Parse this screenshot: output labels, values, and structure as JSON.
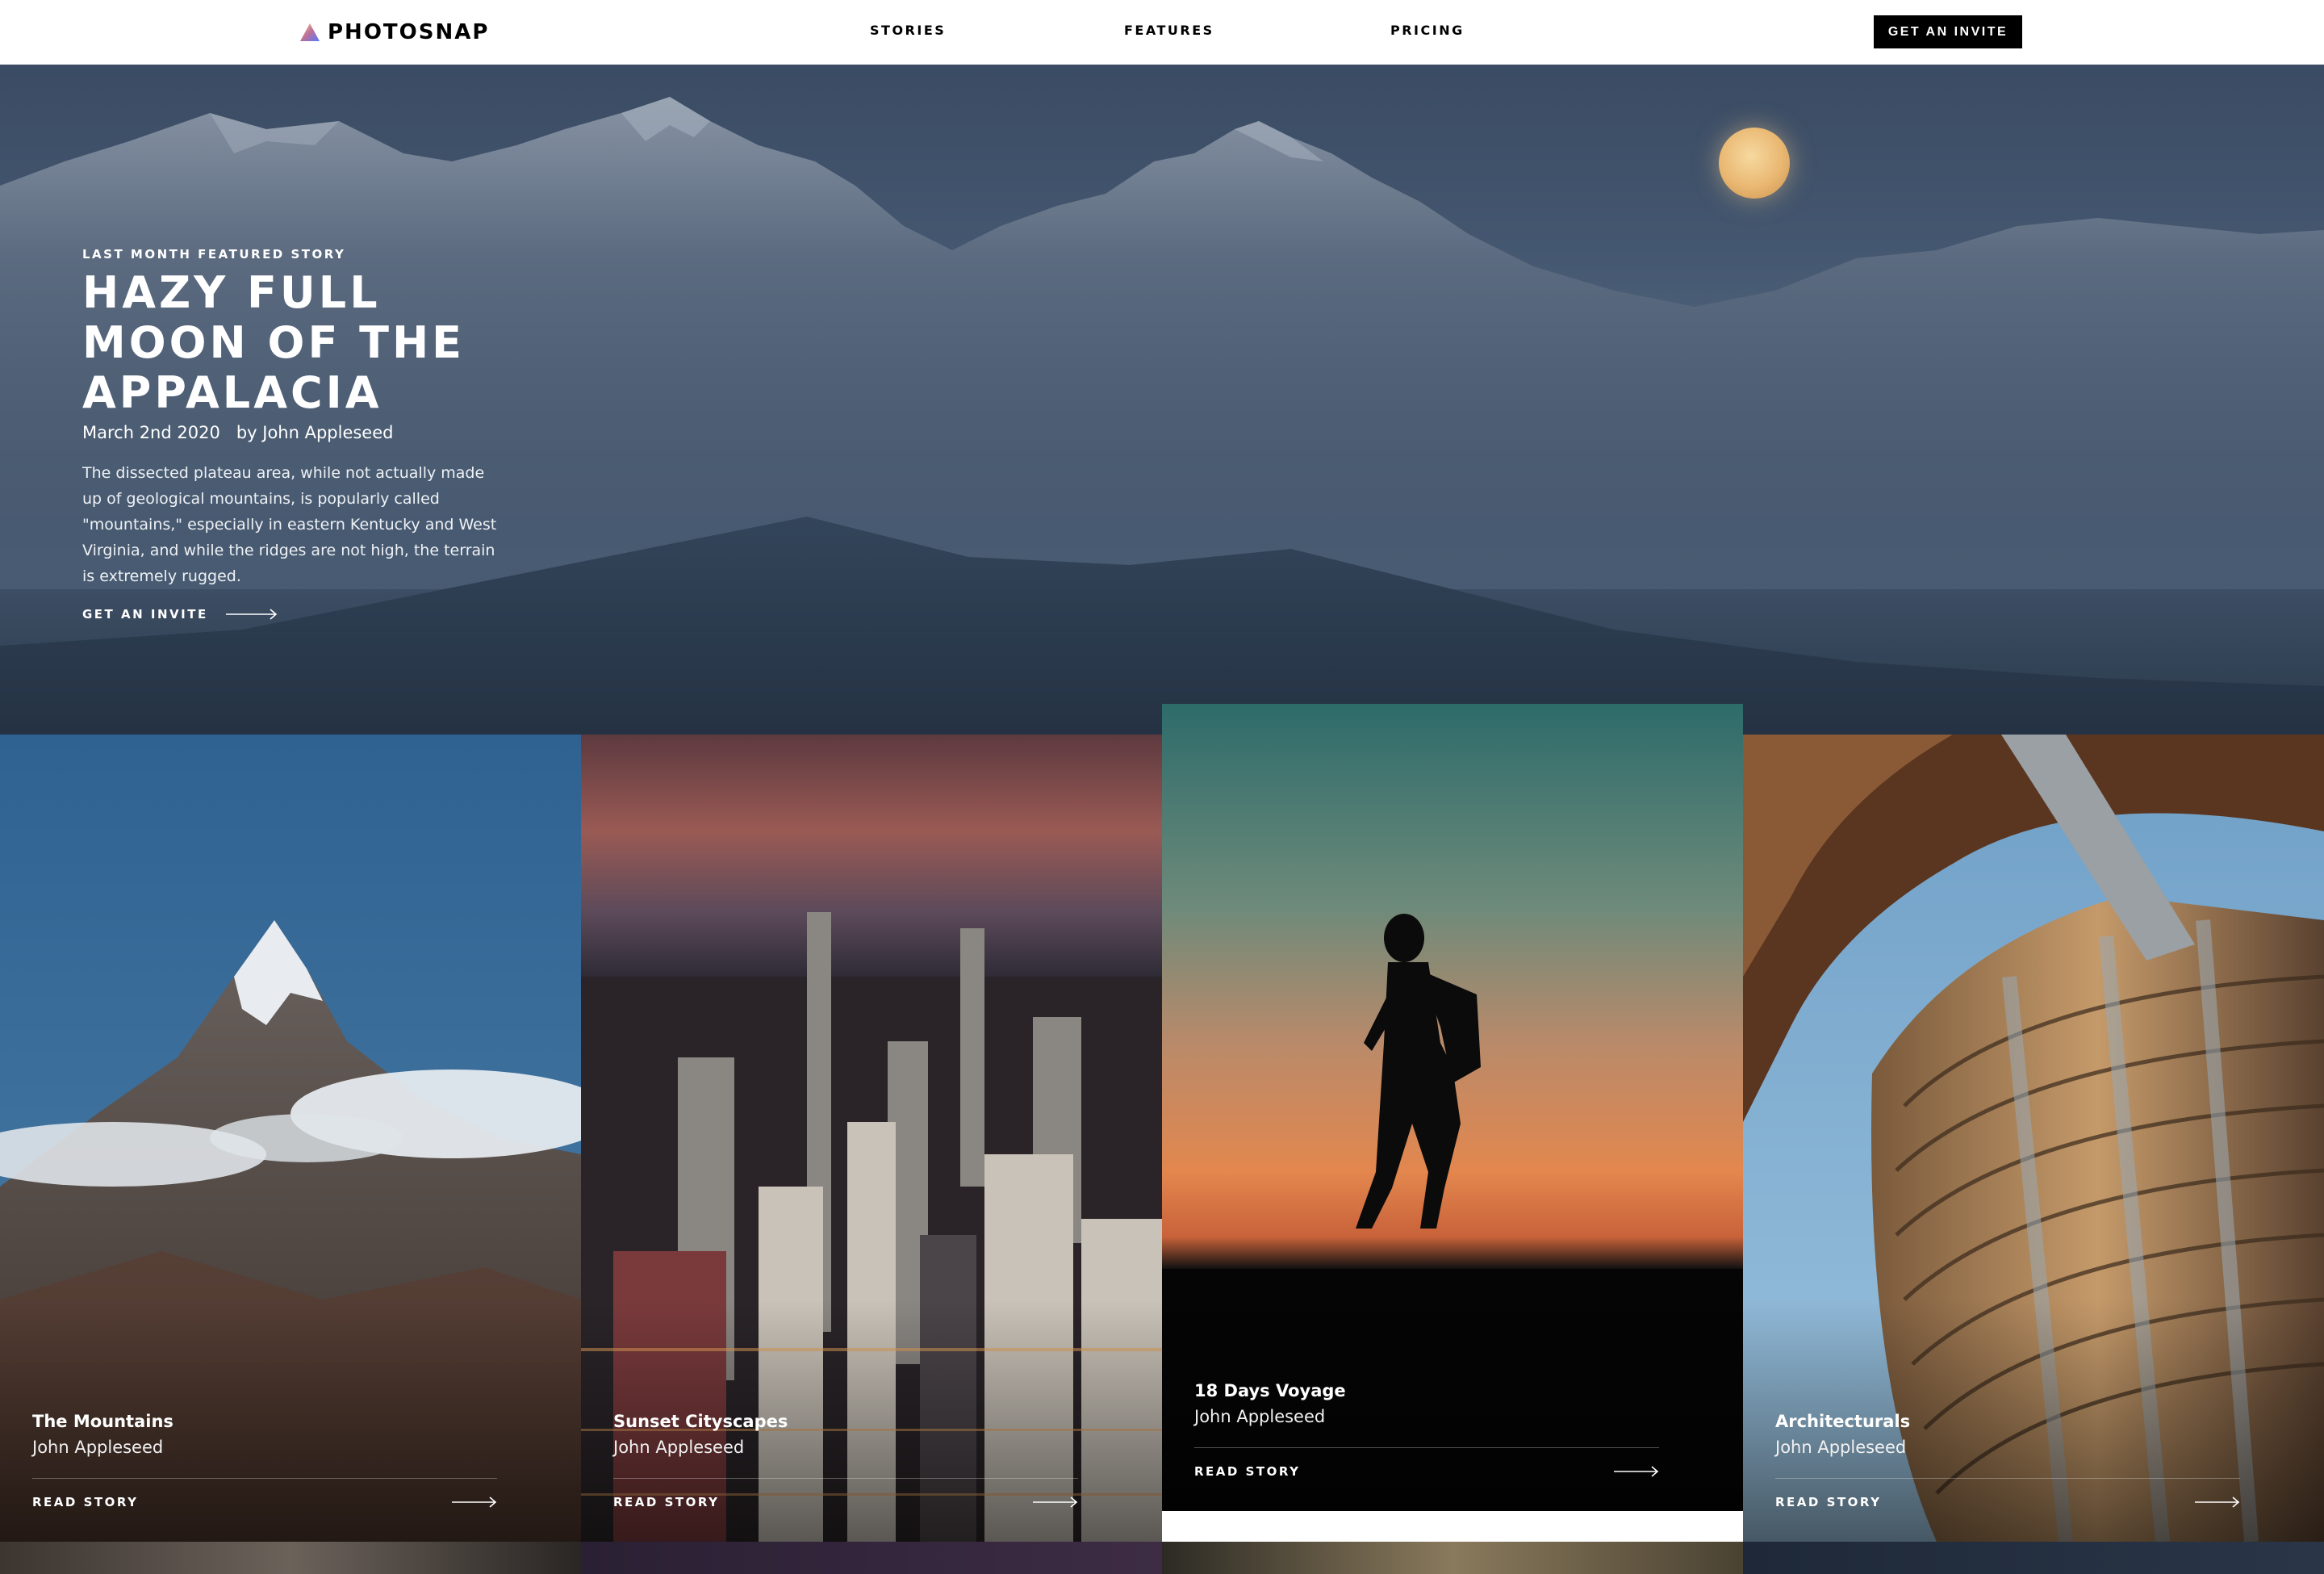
{
  "nav": {
    "logo": "PHOTOSNAP",
    "links": [
      "STORIES",
      "FEATURES",
      "PRICING"
    ],
    "cta": "GET AN INVITE"
  },
  "hero": {
    "eyebrow": "LAST MONTH FEATURED STORY",
    "title": "HAZY FULL MOON OF THE APPALACIA",
    "date": "March 2nd 2020",
    "author": "by John Appleseed",
    "description": "The dissected plateau area, while not actually made up of geological mountains, is popularly called \"mountains,\" especially in eastern Kentucky and West Virginia, and while the ridges are not high, the terrain is extremely rugged.",
    "cta": "GET AN INVITE"
  },
  "cards": [
    {
      "title": "The Mountains",
      "author": "John Appleseed",
      "read": "READ STORY"
    },
    {
      "title": "Sunset Cityscapes",
      "author": "John Appleseed",
      "read": "READ STORY"
    },
    {
      "title": "18 Days Voyage",
      "author": "John Appleseed",
      "read": "READ STORY"
    },
    {
      "title": "Architecturals",
      "author": "John Appleseed",
      "read": "READ STORY"
    }
  ]
}
